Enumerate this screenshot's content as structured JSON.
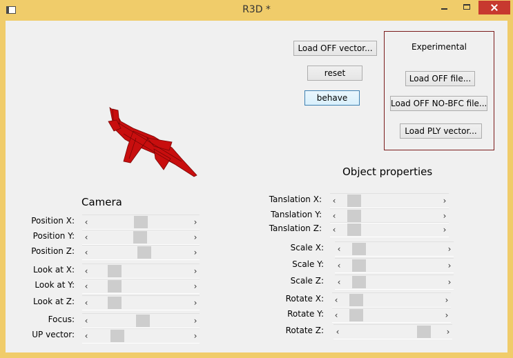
{
  "window": {
    "title": "R3D *"
  },
  "buttons": {
    "load_off_vector": "Load OFF vector...",
    "reset": "reset",
    "behave": "behave"
  },
  "experimental": {
    "title": "Experimental",
    "load_off_file": "Load OFF file...",
    "load_off_nobfc": "Load OFF NO-BFC file...",
    "load_ply_vector": "Load PLY vector..."
  },
  "camera": {
    "title": "Camera",
    "sliders": [
      {
        "label": "Position X:",
        "value": 0.5
      },
      {
        "label": "Position Y:",
        "value": 0.49
      },
      {
        "label": "Position Z:",
        "value": 0.54
      },
      {
        "label": "Look at X:",
        "value": 0.2
      },
      {
        "label": "Look at Y:",
        "value": 0.2
      },
      {
        "label": "Look at Z:",
        "value": 0.2
      },
      {
        "label": "Focus:",
        "value": 0.52
      },
      {
        "label": "UP vector:",
        "value": 0.23
      }
    ]
  },
  "object": {
    "title": "Object properties",
    "sliders": [
      {
        "label": "Tanslation X:",
        "value": 0.1
      },
      {
        "label": "Tanslation Y:",
        "value": 0.1
      },
      {
        "label": "Tanslation Z:",
        "value": 0.1
      },
      {
        "label": "Scale X:",
        "value": 0.1
      },
      {
        "label": "Scale Y:",
        "value": 0.1
      },
      {
        "label": "Scale Z:",
        "value": 0.1
      },
      {
        "label": "Rotate X:",
        "value": 0.1
      },
      {
        "label": "Rotate Y:",
        "value": 0.1
      },
      {
        "label": "Rotate Z:",
        "value": 0.85
      }
    ]
  },
  "viewport": {
    "model_color": "#d01010"
  }
}
